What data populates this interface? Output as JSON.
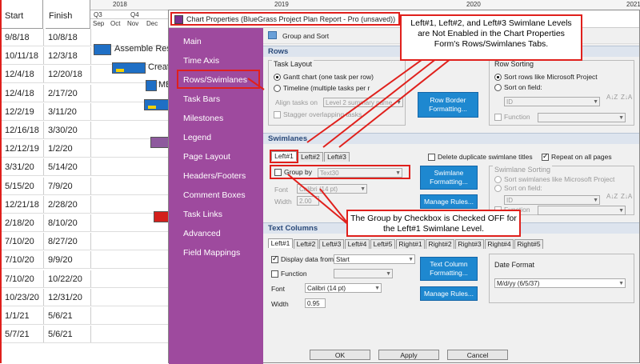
{
  "gantt": {
    "start_header": "Start",
    "finish_header": "Finish",
    "years": [
      "2018",
      "2019",
      "2020",
      "2021"
    ],
    "quarters": [
      "Q3",
      "Q4"
    ],
    "months": [
      "Sep",
      "Oct",
      "Nov",
      "Dec"
    ],
    "rows": [
      {
        "start": "9/8/18",
        "finish": "10/8/18"
      },
      {
        "start": "10/11/18",
        "finish": "12/3/18"
      },
      {
        "start": "12/4/18",
        "finish": "12/20/18"
      },
      {
        "start": "12/4/18",
        "finish": "2/17/20"
      },
      {
        "start": "12/2/19",
        "finish": "3/11/20"
      },
      {
        "start": "12/16/18",
        "finish": "3/30/20"
      },
      {
        "start": "12/12/19",
        "finish": "1/2/20"
      },
      {
        "start": "3/31/20",
        "finish": "5/14/20"
      },
      {
        "start": "5/15/20",
        "finish": "7/9/20"
      },
      {
        "start": "12/21/18",
        "finish": "2/28/20"
      },
      {
        "start": "2/18/20",
        "finish": "8/10/20"
      },
      {
        "start": "7/10/20",
        "finish": "8/27/20"
      },
      {
        "start": "7/10/20",
        "finish": "9/9/20"
      },
      {
        "start": "7/10/20",
        "finish": "10/22/20"
      },
      {
        "start": "10/23/20",
        "finish": "12/31/20"
      },
      {
        "start": "1/1/21",
        "finish": "5/6/21"
      },
      {
        "start": "5/7/21",
        "finish": "5/6/21"
      }
    ],
    "bar_labels": [
      "Assemble Res",
      "Creat",
      "MB"
    ]
  },
  "dialog": {
    "title": "Chart Properties (BlueGrass Project Plan Report - Pro (unsaved))",
    "nav_items": [
      "Main",
      "Time Axis",
      "Rows/Swimlanes",
      "Task Bars",
      "Milestones",
      "Legend",
      "Page Layout",
      "Headers/Footers",
      "Comment Boxes",
      "Task Links",
      "Advanced",
      "Field Mappings"
    ],
    "panel_header": "Group and Sort",
    "rows_section": "Rows",
    "task_layout": {
      "title": "Task Layout",
      "gantt_option": "Gantt chart (one task per row)",
      "timeline_option": "Timeline (multiple tasks per r",
      "align_label": "Align tasks on",
      "align_value": "Level 2 summary name",
      "stagger_label": "Stagger overlapping tasks"
    },
    "row_border_button": "Row Border Formatting...",
    "row_sorting": {
      "title": "Row Sorting",
      "like_project": "Sort rows like Microsoft Project",
      "on_field": "Sort on field:",
      "field_value": "ID",
      "function_label": "Function"
    },
    "swimlanes_section": "Swimlanes",
    "swimlane_tabs": [
      "Left#1",
      "Left#2",
      "Left#3"
    ],
    "delete_duplicate": "Delete duplicate swimlane titles",
    "repeat_all_pages": "Repeat on all pages",
    "group_by_label": "Group by",
    "group_by_value": "Text30",
    "font_label": "Font",
    "font_value": "Calibri (14 pt)",
    "width_label": "Width",
    "width_value": "2.00",
    "swimlane_formatting_button": "Swimlane Formatting...",
    "manage_rules_button": "Manage Rules...",
    "swimlane_sorting": {
      "title": "Swimlane Sorting",
      "like_project": "Sort swimlanes like Microsoft Project",
      "on_field": "Sort on field:",
      "field_value": "ID",
      "function_label": "Function"
    },
    "text_columns_section": "Text Columns",
    "text_column_tabs": [
      "Left#1",
      "Left#2",
      "Left#3",
      "Left#4",
      "Left#5",
      "Right#1",
      "Right#2",
      "Right#3",
      "Right#4",
      "Right#5"
    ],
    "display_data_label": "Display data from",
    "display_data_value": "Start",
    "function_label": "Function",
    "tc_font_label": "Font",
    "tc_font_value": "Calibri (14 pt)",
    "tc_width_label": "Width",
    "tc_width_value": "0.95",
    "text_column_formatting_button": "Text Column Formatting...",
    "tc_manage_rules_button": "Manage Rules...",
    "date_format_title": "Date Format",
    "date_format_value": "M/d/yy (6/5/37)",
    "ok_button": "OK",
    "apply_button": "Apply",
    "cancel_button": "Cancel"
  },
  "callouts": {
    "top": "Left#1, Left#2, and Left#3 Swimlane Levels are Not Enabled in the Chart Properties Form's Rows/Swimlanes Tabs.",
    "bottom": "The Group by Checkbox is Checked OFF for the Left#1 Swimlane Level."
  },
  "colors": {
    "nav_purple": "#9e4a9e",
    "accent_red": "#e0201c",
    "button_blue": "#1e88d0"
  }
}
